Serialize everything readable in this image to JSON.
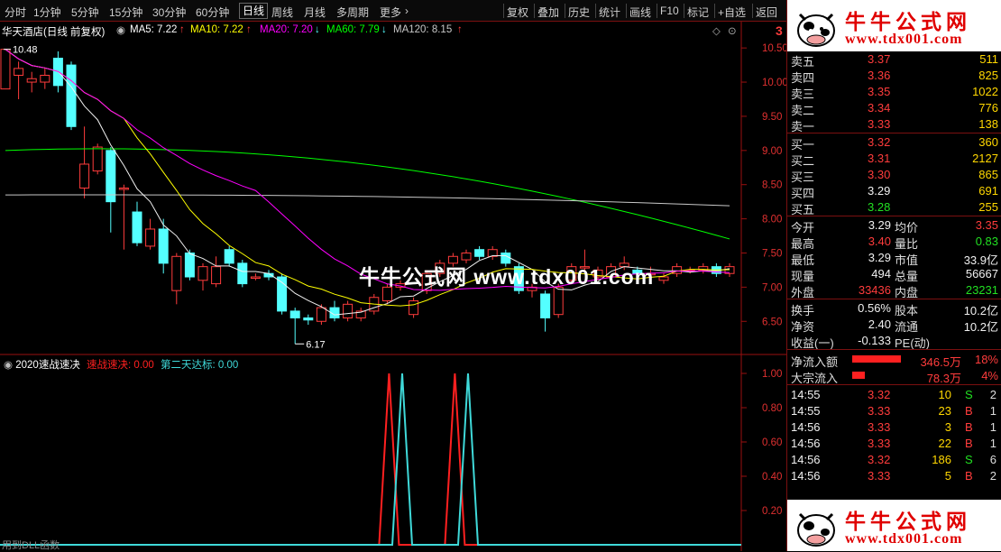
{
  "toolbar": {
    "periods": [
      "分时",
      "1分钟",
      "5分钟",
      "15分钟",
      "30分钟",
      "60分钟",
      "日线",
      "周线",
      "月线",
      "多周期",
      "更多"
    ],
    "active_period": "日线",
    "actions": [
      "复权",
      "叠加",
      "历史",
      "统计",
      "画线",
      "F10",
      "标记",
      "+自选",
      "返回"
    ]
  },
  "header": {
    "stock": "华天酒店(日线 前复权)",
    "ma5": "MA5: 7.22",
    "ma10": "MA10: 7.22",
    "ma20": "MA20: 7.20",
    "ma60": "MA60: 7.79",
    "ma120": "MA120: 8.15",
    "high_label": "10.48",
    "low_label": "6.17",
    "ma20_arrow": "↓",
    "ma60_arrow": "↓",
    "ma120_arrow": "↑",
    "ma5_arrow": "↑",
    "ma10_arrow": "↑",
    "corner_glyph": "3"
  },
  "indicator": {
    "name": "2020速战速决",
    "v1": "速战速决: 0.00",
    "v2": "第二天达标: 0.00",
    "footer": "用到DLL函数"
  },
  "watermark": "牛牛公式网 www.tdx001.com",
  "banner": {
    "title": "牛牛公式网",
    "url": "www.tdx001.com"
  },
  "colors": {
    "up": "#ff3c3c",
    "down": "#54ffff",
    "ma5": "#f0f0f0",
    "ma10": "#ffff00",
    "ma20": "#ff00ff",
    "ma60": "#00ff00",
    "ma120": "#c8c8c8"
  },
  "chart_data": [
    {
      "type": "candlestick",
      "title": "华天酒店(日线 前复权)",
      "ylim": [
        6.2,
        10.7
      ],
      "yticks": [
        "10.50",
        "10.00",
        "9.50",
        "9.00",
        "8.50",
        "8.00",
        "7.50",
        "7.00",
        "6.50"
      ],
      "candles": [
        [
          9.9,
          10.48,
          10.45,
          9.95
        ],
        [
          10.1,
          10.2,
          10.3,
          9.75
        ],
        [
          10.0,
          10.05,
          10.15,
          9.85
        ],
        [
          10.0,
          10.1,
          10.2,
          9.9
        ],
        [
          10.35,
          9.95,
          10.45,
          9.85
        ],
        [
          10.25,
          9.35,
          10.3,
          9.3
        ],
        [
          8.45,
          8.8,
          9.35,
          8.3
        ],
        [
          8.7,
          9.05,
          9.1,
          8.65
        ],
        [
          9.0,
          8.25,
          9.05,
          7.8
        ],
        [
          8.45,
          8.45,
          8.5,
          7.55
        ],
        [
          8.1,
          7.65,
          8.25,
          7.6
        ],
        [
          7.6,
          7.85,
          8.0,
          7.55
        ],
        [
          7.85,
          7.35,
          8.0,
          7.2
        ],
        [
          6.95,
          7.45,
          7.5,
          6.75
        ],
        [
          7.5,
          7.15,
          7.55,
          7.1
        ],
        [
          7.1,
          7.3,
          7.35,
          6.95
        ],
        [
          7.05,
          7.3,
          7.45,
          7.0
        ],
        [
          7.55,
          7.35,
          7.6,
          7.3
        ],
        [
          7.35,
          7.05,
          7.4,
          7.0
        ],
        [
          7.15,
          7.15,
          7.2,
          7.1
        ],
        [
          7.2,
          7.15,
          7.25,
          7.1
        ],
        [
          7.15,
          6.65,
          7.2,
          6.6
        ],
        [
          6.65,
          6.55,
          6.7,
          6.17
        ],
        [
          6.55,
          6.52,
          6.6,
          6.45
        ],
        [
          6.5,
          6.7,
          6.75,
          6.45
        ],
        [
          6.7,
          6.55,
          6.8,
          6.5
        ],
        [
          6.55,
          6.75,
          6.8,
          6.5
        ],
        [
          6.55,
          6.65,
          6.7,
          6.5
        ],
        [
          6.65,
          6.85,
          6.9,
          6.6
        ],
        [
          6.8,
          7.0,
          7.05,
          6.75
        ],
        [
          7.0,
          7.05,
          7.1,
          6.95
        ],
        [
          6.6,
          6.8,
          6.85,
          6.55
        ],
        [
          6.95,
          7.2,
          7.25,
          6.9
        ],
        [
          7.2,
          7.35,
          7.4,
          7.15
        ],
        [
          7.35,
          7.45,
          7.5,
          7.3
        ],
        [
          7.4,
          7.5,
          7.55,
          7.35
        ],
        [
          7.55,
          7.45,
          7.6,
          7.4
        ],
        [
          7.45,
          7.55,
          7.6,
          7.4
        ],
        [
          7.5,
          7.35,
          7.55,
          7.3
        ],
        [
          7.3,
          6.95,
          7.35,
          6.9
        ],
        [
          6.95,
          7.0,
          7.05,
          6.85
        ],
        [
          6.9,
          6.55,
          6.95,
          6.35
        ],
        [
          6.6,
          7.0,
          7.05,
          6.55
        ],
        [
          7.1,
          7.3,
          7.35,
          7.05
        ],
        [
          7.3,
          7.3,
          7.55,
          7.25
        ],
        [
          7.15,
          7.25,
          7.3,
          7.1
        ],
        [
          7.15,
          7.3,
          7.35,
          7.1
        ],
        [
          7.3,
          7.35,
          7.45,
          7.25
        ],
        [
          7.25,
          7.2,
          7.3,
          7.15
        ],
        [
          7.2,
          7.2,
          7.3,
          7.15
        ],
        [
          7.1,
          7.15,
          7.2,
          7.05
        ],
        [
          7.2,
          7.3,
          7.35,
          7.15
        ],
        [
          7.25,
          7.25,
          7.3,
          7.2
        ],
        [
          7.25,
          7.3,
          7.35,
          7.2
        ],
        [
          7.3,
          7.2,
          7.35,
          7.15
        ],
        [
          7.2,
          7.3,
          7.35,
          7.15
        ]
      ]
    },
    {
      "type": "line",
      "ylim": [
        0,
        1.0
      ],
      "yticks": [
        "1.00",
        "0.80",
        "0.60",
        "0.40",
        "0.20"
      ],
      "series": [
        {
          "name": "速战速决",
          "color": "#ff2020",
          "spikes_at": [
            29,
            34
          ]
        },
        {
          "name": "第二天达标",
          "color": "#3fd9d9",
          "spikes_at": [
            30,
            35
          ]
        }
      ]
    }
  ],
  "quote": {
    "sell": [
      [
        "卖五",
        "3.37",
        "511"
      ],
      [
        "卖四",
        "3.36",
        "825"
      ],
      [
        "卖三",
        "3.35",
        "1022"
      ],
      [
        "卖二",
        "3.34",
        "776"
      ],
      [
        "卖一",
        "3.33",
        "138"
      ]
    ],
    "buy": [
      [
        "买一",
        "3.32",
        "360"
      ],
      [
        "买二",
        "3.31",
        "2127"
      ],
      [
        "买三",
        "3.30",
        "865"
      ],
      [
        "买四",
        "3.29",
        "691"
      ],
      [
        "买五",
        "3.28",
        "255"
      ]
    ],
    "stats": [
      [
        "今开",
        "3.29",
        "均价",
        "3.35"
      ],
      [
        "最高",
        "3.40",
        "量比",
        "0.83"
      ],
      [
        "最低",
        "3.29",
        "市值",
        "33.9亿"
      ],
      [
        "现量",
        "494",
        "总量",
        "56667"
      ],
      [
        "外盘",
        "33436",
        "内盘",
        "23231"
      ]
    ],
    "fin": [
      [
        "换手",
        "0.56%",
        "股本",
        "10.2亿"
      ],
      [
        "净资",
        "2.40",
        "流通",
        "10.2亿"
      ],
      [
        "收益(一)",
        "-0.133",
        "PE(动)",
        ""
      ]
    ],
    "flow": [
      [
        "净流入额",
        "346.5万",
        "18%"
      ],
      [
        "大宗流入",
        "78.3万",
        "4%"
      ]
    ],
    "ticks": [
      [
        "14:55",
        "3.32",
        "10",
        "S",
        "2"
      ],
      [
        "14:55",
        "3.33",
        "23",
        "B",
        "1"
      ],
      [
        "14:56",
        "3.33",
        "3",
        "B",
        "1"
      ],
      [
        "14:56",
        "3.33",
        "22",
        "B",
        "1"
      ],
      [
        "14:56",
        "3.32",
        "186",
        "S",
        "6"
      ],
      [
        "14:56",
        "3.33",
        "5",
        "B",
        "2"
      ]
    ]
  }
}
